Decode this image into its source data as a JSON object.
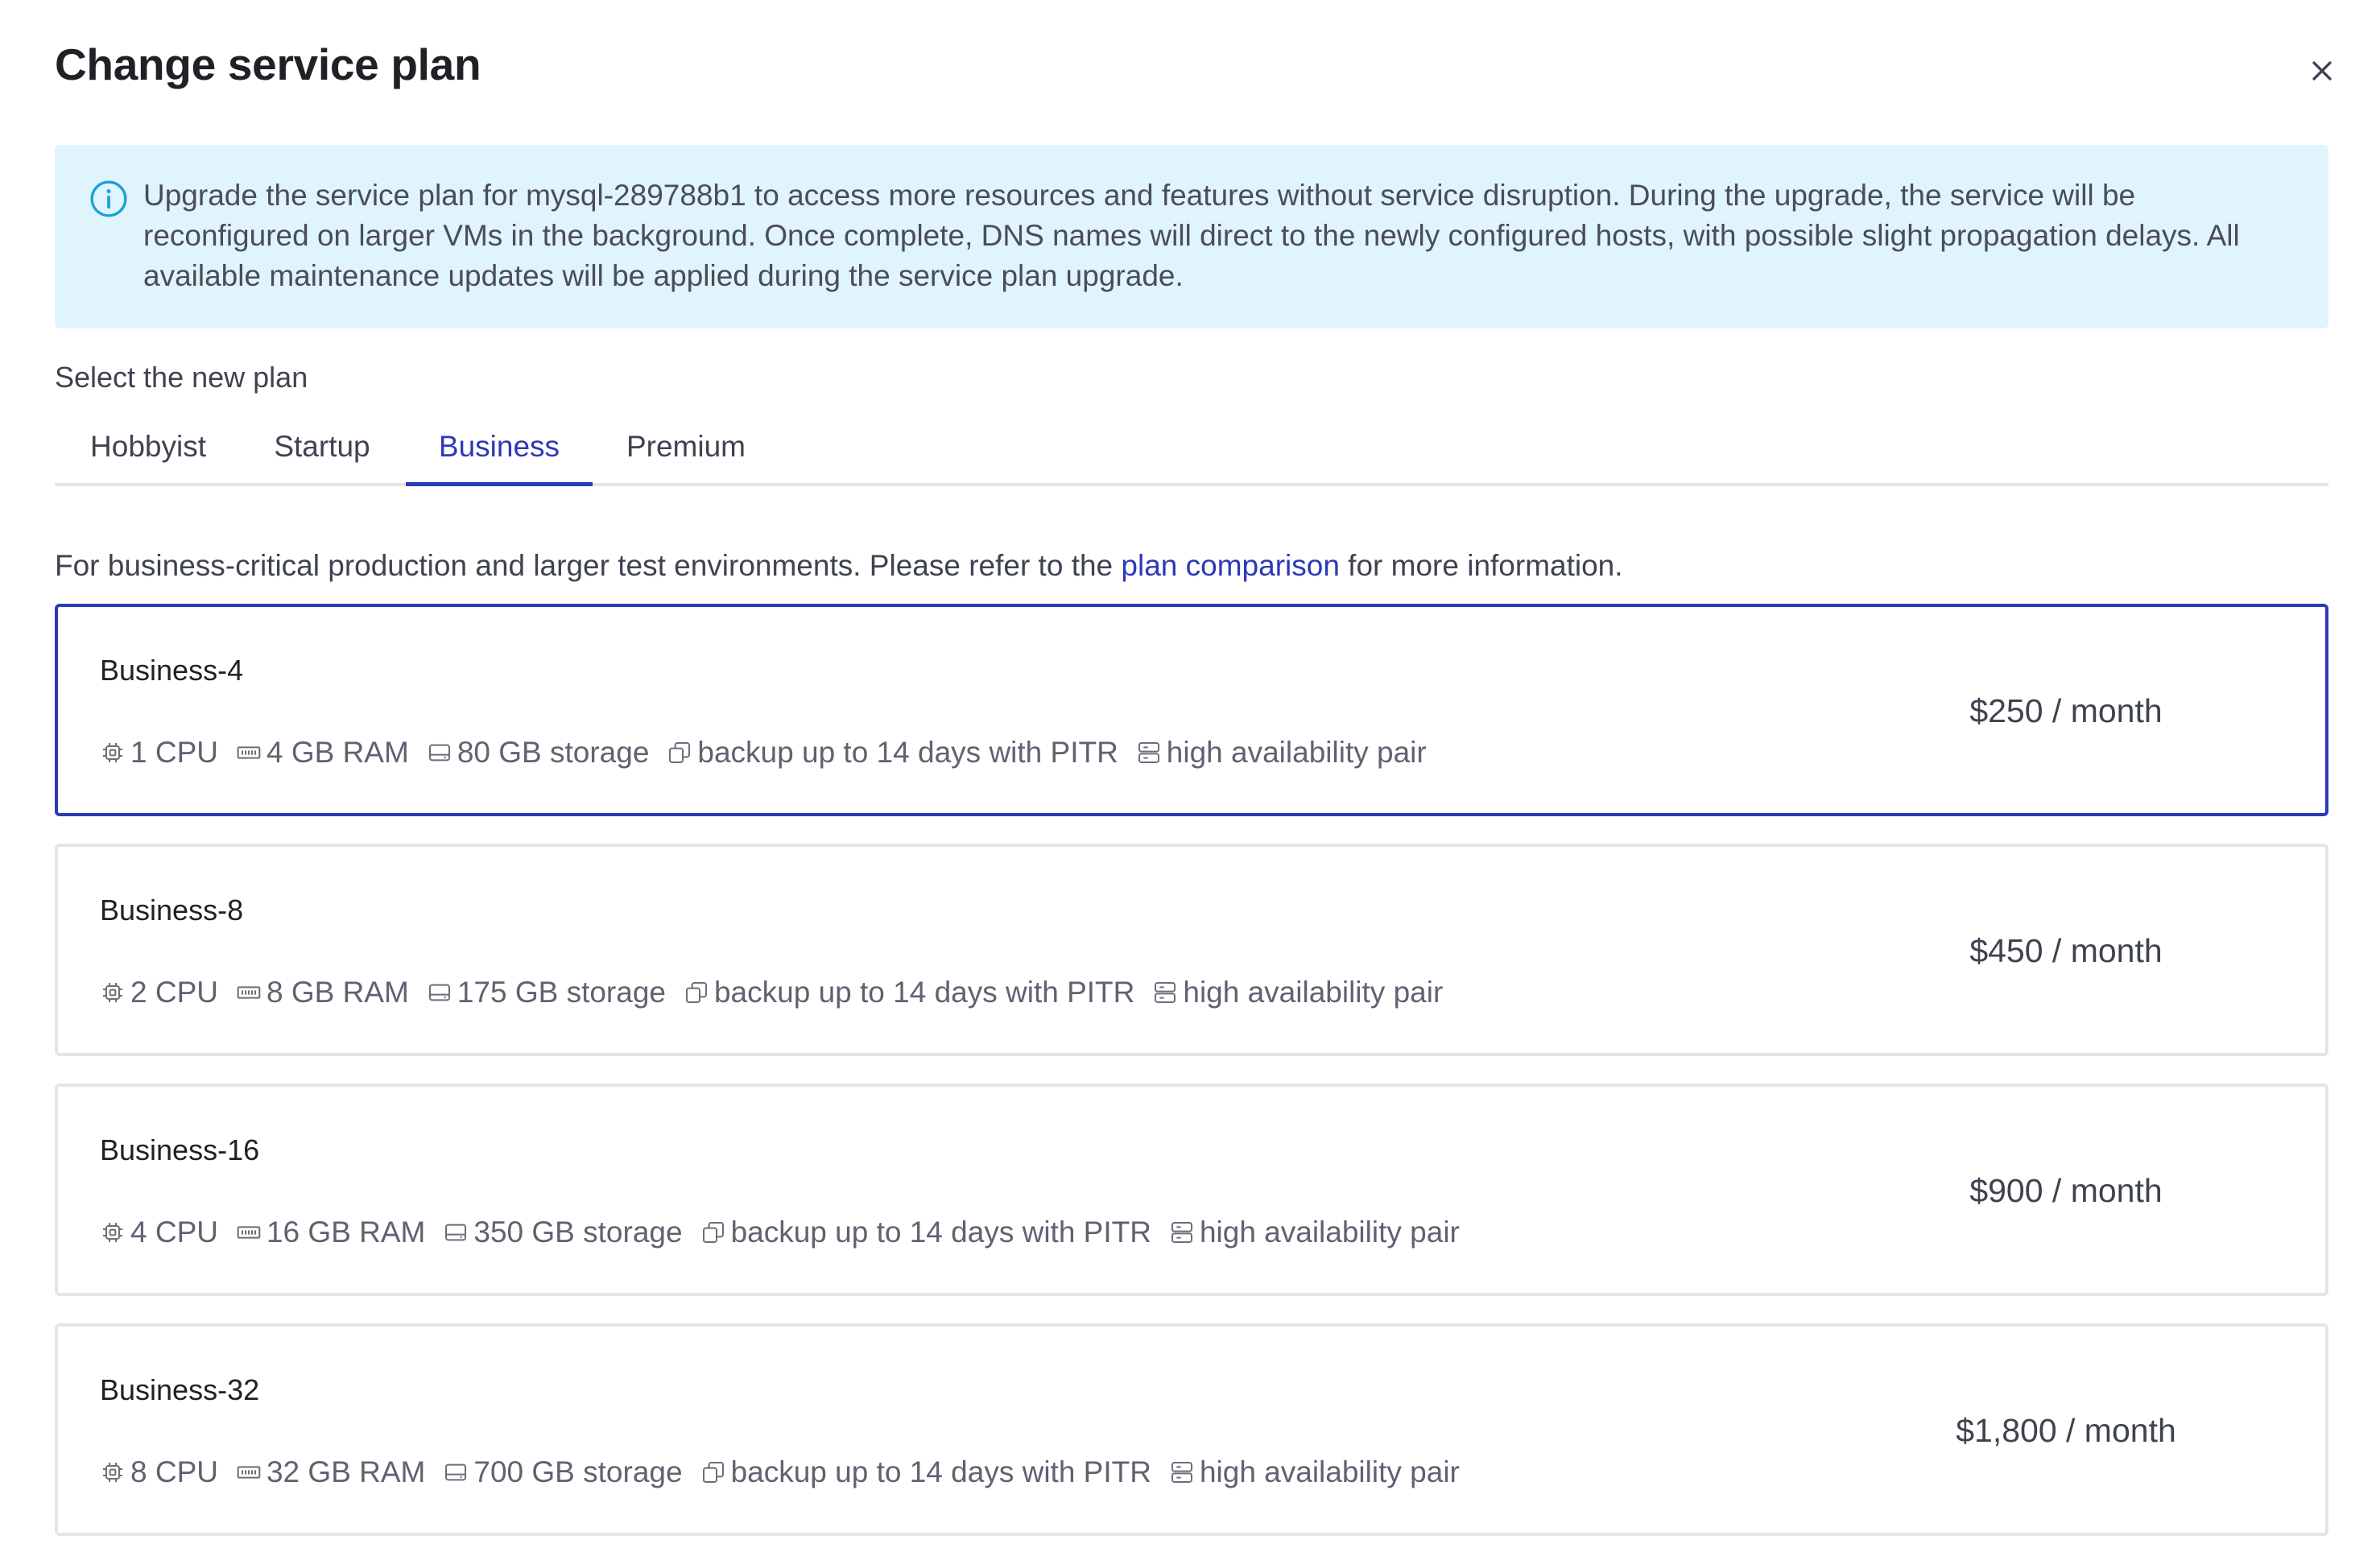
{
  "dialog": {
    "title": "Change service plan",
    "close_icon": "close-icon"
  },
  "info": {
    "icon": "info-icon",
    "text": "Upgrade the service plan for mysql-289788b1 to access more resources and features without service disruption. During the upgrade, the service will be reconfigured on larger VMs in the background. Once complete, DNS names will direct to the newly configured hosts, with possible slight propagation delays. All available maintenance updates will be applied during the service plan upgrade."
  },
  "select_label": "Select the new plan",
  "tabs": [
    {
      "label": "Hobbyist",
      "active": false
    },
    {
      "label": "Startup",
      "active": false
    },
    {
      "label": "Business",
      "active": true
    },
    {
      "label": "Premium",
      "active": false
    }
  ],
  "description": {
    "before": "For business-critical production and larger test environments. Please refer to the ",
    "link": "plan comparison",
    "after": " for more information."
  },
  "plans": [
    {
      "name": "Business-4",
      "cpu": "1 CPU",
      "ram": "4 GB RAM",
      "storage": "80 GB storage",
      "backup": "backup up to 14 days with PITR",
      "ha": "high availability pair",
      "price": "$250 / month",
      "selected": true
    },
    {
      "name": "Business-8",
      "cpu": "2 CPU",
      "ram": "8 GB RAM",
      "storage": "175 GB storage",
      "backup": "backup up to 14 days with PITR",
      "ha": "high availability pair",
      "price": "$450 / month",
      "selected": false
    },
    {
      "name": "Business-16",
      "cpu": "4 CPU",
      "ram": "16 GB RAM",
      "storage": "350 GB storage",
      "backup": "backup up to 14 days with PITR",
      "ha": "high availability pair",
      "price": "$900 / month",
      "selected": false
    },
    {
      "name": "Business-32",
      "cpu": "8 CPU",
      "ram": "32 GB RAM",
      "storage": "700 GB storage",
      "backup": "backup up to 14 days with PITR",
      "ha": "high availability pair",
      "price": "$1,800 / month",
      "selected": false
    }
  ],
  "colors": {
    "accent": "#2c39b8",
    "info_bg": "#e0f4fc",
    "info_icon": "#1ba0d8",
    "border": "#e3e5ea",
    "text": "#3f4350"
  },
  "icons": {
    "cpu": "cpu-icon",
    "ram": "memory-icon",
    "storage": "storage-icon",
    "backup": "backup-icon",
    "ha": "server-pair-icon"
  }
}
